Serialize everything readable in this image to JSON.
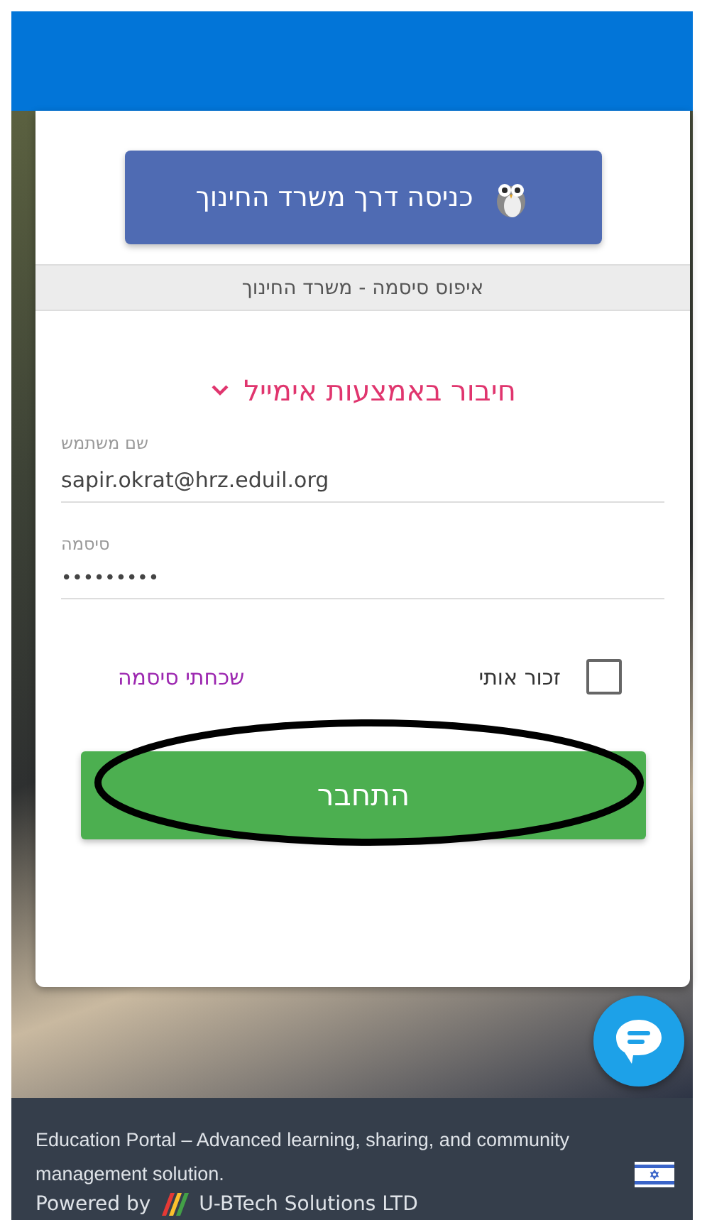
{
  "sso_button": {
    "label": "כניסה דרך משרד החינוך"
  },
  "reset_link": {
    "label": "איפוס סיסמה - משרד החינוך"
  },
  "email_section": {
    "title": "חיבור באמצעות אימייל"
  },
  "fields": [
    {
      "label": "שם משתמש",
      "value": "sapir.okrat@hrz.eduil.org",
      "kind": "text"
    },
    {
      "label": "סיסמה",
      "value": "•••••••••",
      "kind": "password"
    }
  ],
  "remember": {
    "label": "זכור אותי",
    "checked": false
  },
  "forgot_link": {
    "label": "שכחתי סיסמה"
  },
  "login_button": {
    "label": "התחבר",
    "circled": true
  },
  "footer": {
    "description": "Education Portal – Advanced learning, sharing, and community management solution.",
    "powered_by": "Powered by",
    "company": "U-BTech Solutions LTD"
  }
}
